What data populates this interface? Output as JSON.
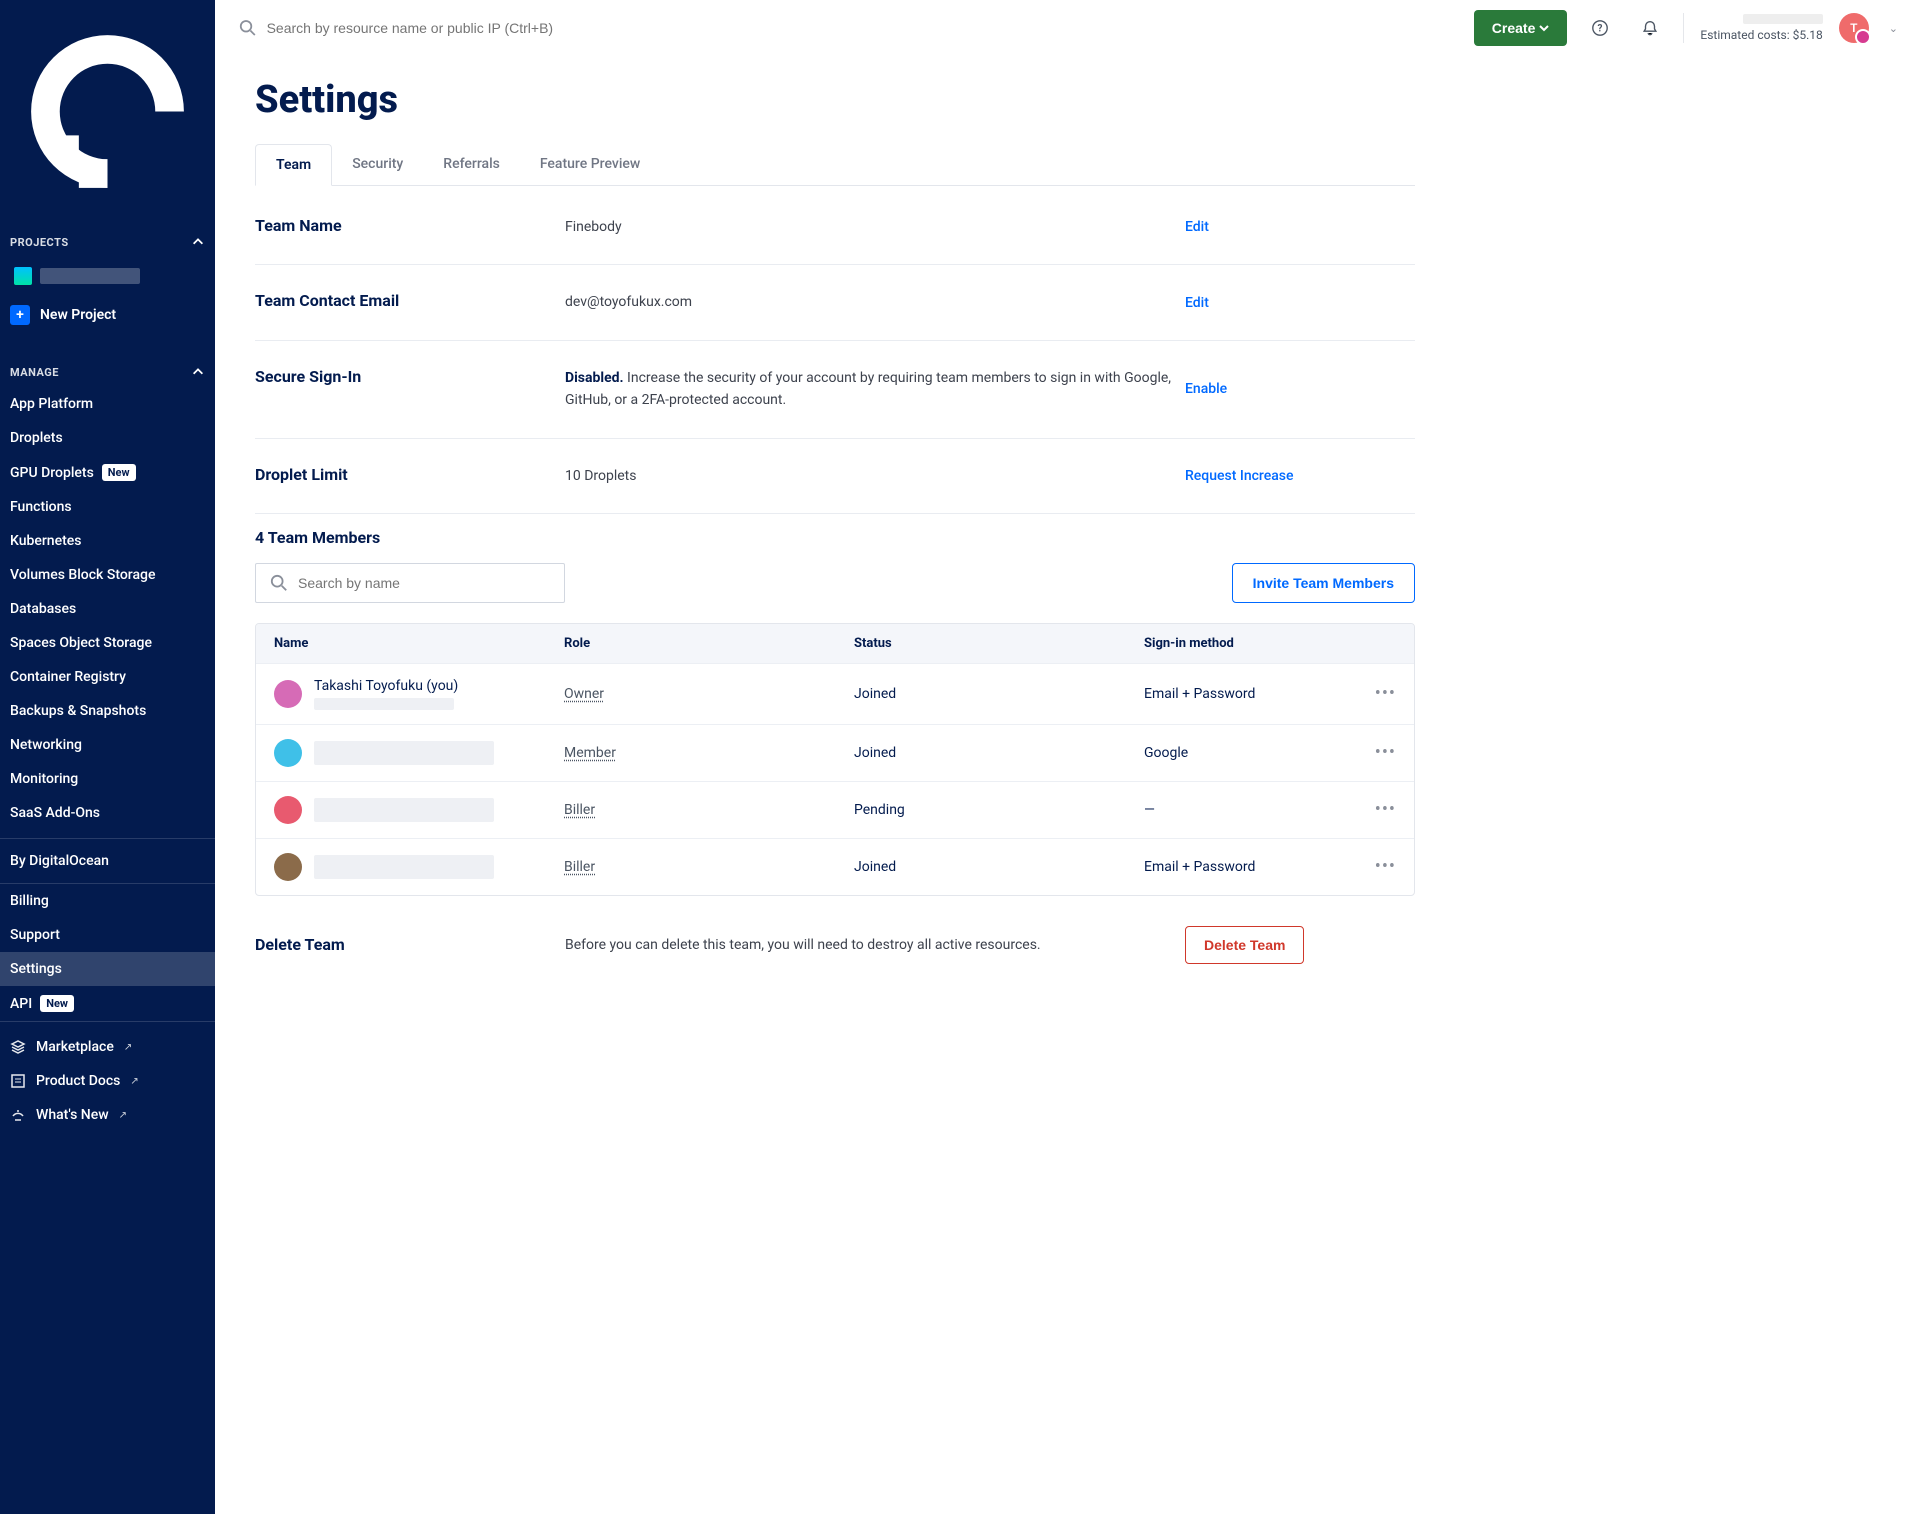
{
  "topbar": {
    "search_placeholder": "Search by resource name or public IP (Ctrl+B)",
    "create_label": "Create",
    "estimated_label": "Estimated costs: $5.18",
    "avatar_letter": "T"
  },
  "sidebar": {
    "projects_label": "PROJECTS",
    "new_project_label": "New Project",
    "manage_label": "MANAGE",
    "manage_items": [
      {
        "label": "App Platform"
      },
      {
        "label": "Droplets"
      },
      {
        "label": "GPU Droplets",
        "badge": "New"
      },
      {
        "label": "Functions"
      },
      {
        "label": "Kubernetes"
      },
      {
        "label": "Volumes Block Storage"
      },
      {
        "label": "Databases"
      },
      {
        "label": "Spaces Object Storage"
      },
      {
        "label": "Container Registry"
      },
      {
        "label": "Backups & Snapshots"
      },
      {
        "label": "Networking"
      },
      {
        "label": "Monitoring"
      },
      {
        "label": "SaaS Add-Ons"
      }
    ],
    "by_label": "By DigitalOcean",
    "lower_items": [
      {
        "label": "Billing"
      },
      {
        "label": "Support"
      },
      {
        "label": "Settings",
        "active": true
      },
      {
        "label": "API",
        "badge": "New"
      }
    ],
    "bottom_items": [
      {
        "label": "Marketplace"
      },
      {
        "label": "Product Docs"
      },
      {
        "label": "What's New"
      }
    ]
  },
  "page": {
    "title": "Settings",
    "tabs": [
      "Team",
      "Security",
      "Referrals",
      "Feature Preview"
    ],
    "rows": {
      "team_name_label": "Team Name",
      "team_name_value": "Finebody",
      "team_name_action": "Edit",
      "contact_label": "Team Contact Email",
      "contact_value": "dev@toyofukux.com",
      "contact_action": "Edit",
      "signin_label": "Secure Sign-In",
      "signin_prefix": "Disabled.",
      "signin_text": " Increase the security of your account by requiring team members to sign in with Google, GitHub, or a 2FA-protected account.",
      "signin_action": "Enable",
      "limit_label": "Droplet Limit",
      "limit_value": "10 Droplets",
      "limit_action": "Request Increase"
    },
    "members": {
      "header": "4 Team Members",
      "search_placeholder": "Search by name",
      "invite_label": "Invite Team Members",
      "columns": {
        "name": "Name",
        "role": "Role",
        "status": "Status",
        "signin": "Sign-in method"
      },
      "rows": [
        {
          "name": "Takashi Toyofuku (you)",
          "role": "Owner",
          "status": "Joined",
          "signin": "Email + Password",
          "avatar_bg": "#d66bb6"
        },
        {
          "name": "",
          "role": "Member",
          "status": "Joined",
          "signin": "Google",
          "avatar_bg": "#3fc0e8"
        },
        {
          "name": "",
          "role": "Biller",
          "status": "Pending",
          "signin": "—",
          "avatar_bg": "#e85a6f"
        },
        {
          "name": "",
          "role": "Biller",
          "status": "Joined",
          "signin": "Email + Password",
          "avatar_bg": "#8b6b4a"
        }
      ]
    },
    "delete": {
      "label": "Delete Team",
      "text": "Before you can delete this team, you will need to destroy all active resources.",
      "button": "Delete Team"
    }
  }
}
